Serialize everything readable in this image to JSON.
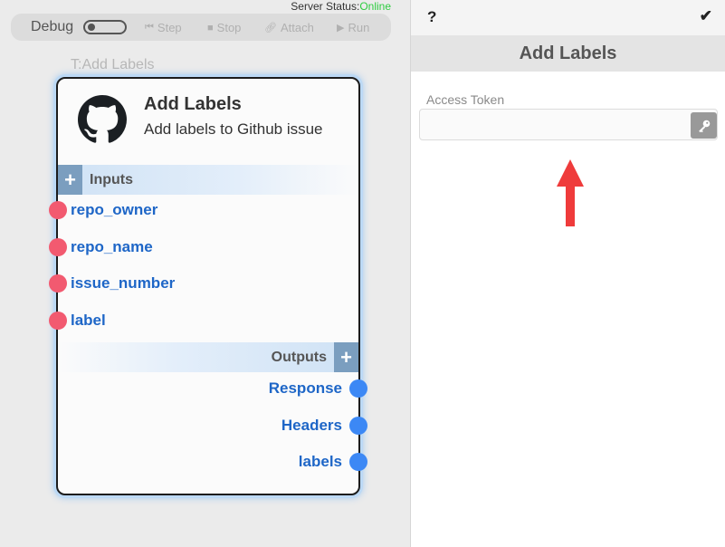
{
  "server_status": {
    "label": "Server Status:",
    "value": "Online"
  },
  "debug_bar": {
    "label": "Debug",
    "buttons": [
      {
        "label": "Step",
        "icon": "step-icon"
      },
      {
        "label": "Stop",
        "icon": "stop-icon"
      },
      {
        "label": "Attach",
        "icon": "link-icon"
      },
      {
        "label": "Run",
        "icon": "play-icon"
      }
    ]
  },
  "node": {
    "caption": "T:Add Labels",
    "name": "Add Labels",
    "description": "Add labels to Github issue",
    "icon": "github-icon",
    "inputs_label": "Inputs",
    "outputs_label": "Outputs",
    "inputs": [
      "repo_owner",
      "repo_name",
      "issue_number",
      "label"
    ],
    "outputs": [
      "Response",
      "Headers",
      "labels"
    ],
    "colors": {
      "input_port": "#f25a70",
      "output_port": "#3c88f5",
      "port_text": "#1e66c7"
    }
  },
  "panel": {
    "help": "?",
    "confirm": "✔",
    "title": "Add Labels",
    "field_label": "Access Token",
    "field_value": "",
    "field_placeholder": ""
  }
}
